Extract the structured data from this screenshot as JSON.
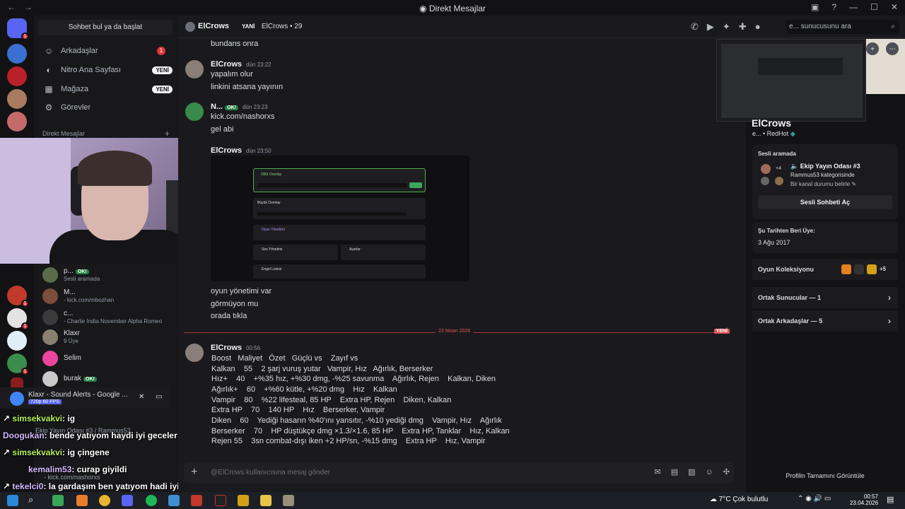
{
  "window": {
    "title": "Direkt Mesajlar"
  },
  "dm": {
    "search": "Sohbet bul ya da başlat",
    "nav": [
      {
        "label": "Arkadaşlar",
        "badge": "1"
      },
      {
        "label": "Nitro Ana Sayfası",
        "badge": "YENİ"
      },
      {
        "label": "Mağaza",
        "badge": "YENİ"
      },
      {
        "label": "Görevler",
        "badge": ""
      }
    ],
    "header": "Direkt Mesajlar",
    "items": [
      {
        "name": "p...",
        "tag": "OK!",
        "sub": "Sesli aramada"
      },
      {
        "name": "M...",
        "sub": "- kick.com/mbozhan"
      },
      {
        "name": "c...",
        "sub": "- Charlie India November Alpha Romeo"
      },
      {
        "name": "Klaxr",
        "sub": "9 Üye"
      },
      {
        "name": "Selim",
        "sub": ""
      },
      {
        "name": "burak",
        "tag": "OK!",
        "sub": ""
      }
    ]
  },
  "overlay": {
    "title": "Klaxr - Sound Alerts - Google ...",
    "quality": "720p 60 FPS"
  },
  "chat_overlay": [
    {
      "user": "simsekvakvi",
      "text": ": ig"
    },
    {
      "user": "Doogukan",
      "text": ": bende yatıyom haydi iyi geceler"
    },
    {
      "user": "simsekvakvi",
      "text": ": ig çingene"
    },
    {
      "user": "kemalim53",
      "text": ": curap giyildi"
    },
    {
      "user": "tekelci0",
      "text": ": la gardaşım ben yatıyom hadi iyi geceler herkese iyi yayınlar"
    }
  ],
  "user_panel": {
    "line1": "Ekip Yayın Odası #3 / Rammus53",
    "line2": "- kick.com/nashorxs"
  },
  "header": {
    "name": "ElCrows",
    "yeni": "YANİ",
    "tag": "ElCrows • 29",
    "search": "e... sunucusunu ara"
  },
  "messages": {
    "m0": "bundans onra",
    "m1": {
      "author": "ElCrows",
      "time": "dün 23:22",
      "lines": [
        "yapalım olur",
        "linkini atsana yayının"
      ]
    },
    "m2": {
      "author": "N...",
      "tag": "OK!",
      "time": "dün 23:23",
      "lines": [
        "kick.com/nashorxs",
        "gel abi"
      ]
    },
    "m3": {
      "author": "ElCrows",
      "time": "dün 23:50",
      "lines": [
        "oyun yönetimi var",
        "görmüyon mu",
        "orada tıkla"
      ]
    },
    "divider": "23 Nisan 2026",
    "divider_new": "YENİ",
    "m4": {
      "author": "ElCrows",
      "time": "00:56"
    }
  },
  "embed": {
    "p1_title": "OBS Overlay",
    "p2_title": "Büyük Overlay",
    "p3_title": "Oyun Yönetimi",
    "p4_title": "Ses Yönetimi",
    "p5_title": "Ayarlar",
    "p6_title": "Engel Listesi"
  },
  "table": [
    "Boost   Maliyet   Özet   Güçlü vs    Zayıf vs",
    "Kalkan    55    2 şarj vuruş yutar   Vampir, Hız   Ağırlık, Berserker",
    "Hız+    40    +%35 hız, +%30 dmg, -%25 savunma    Ağırlık, Rejen    Kalkan, Diken",
    "Ağırlık+    60    +%60 kütle, +%20 dmg    Hız    Kalkan",
    "Vampir    80    %22 lifesteal, 85 HP    Extra HP, Rejen    Diken, Kalkan",
    "Extra HP    70    140 HP    Hız    Berserker, Vampir",
    "Diken    60    Yediği hasarın %40'ını yansıtır, -%10 yediği dmg    Vampir, Hız    Ağırlık",
    "Berserker    70    HP düştükçe dmg ×1.3/×1.6, 85 HP    Extra HP, Tanklar    Hız, Kalkan",
    "Rejen 55    3sn combat-dışı iken +2 HP/sn, -%15 dmg    Extra HP    Hız, Vampir"
  ],
  "composer": {
    "placeholder": "@ElCrows kullanıcısına mesaj gönder"
  },
  "profile": {
    "name": "ElCrows",
    "sub": "e... • RedHot",
    "voice_header": "Sesli aramada",
    "voice_room": "Ekip Yayın Odası #3",
    "voice_cat": "Rammus53 kategorisinde",
    "voice_status": "Bir kanal durumu belirle",
    "voice_count": "+4",
    "voice_btn": "Sesli Sohbeti Aç",
    "member_header": "Şu Tarihten Beri Üye:",
    "member_date": "3 Ağu 2017",
    "games": "Oyun Koleksiyonu",
    "games_more": "+5",
    "mutual_servers": "Ortak Sunucular — 1",
    "mutual_friends": "Ortak Arkadaşlar — 5",
    "full": "Profilin Tamamını Görüntüle"
  },
  "taskbar": {
    "weather": "7°C  Çok bulutlu",
    "time": "00:57",
    "date": "23.04.2026"
  }
}
